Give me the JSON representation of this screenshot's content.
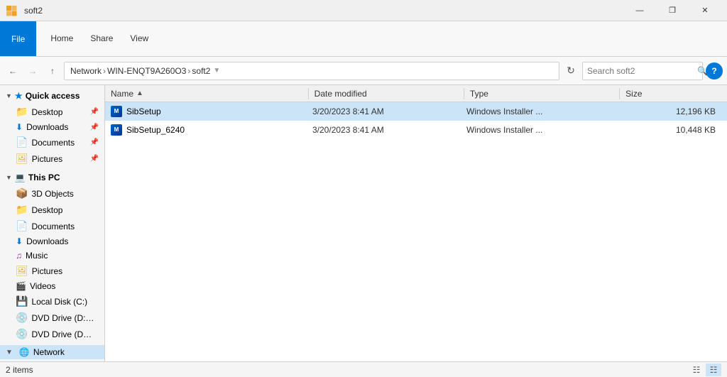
{
  "titleBar": {
    "title": "soft2",
    "minimizeLabel": "—",
    "restoreLabel": "❐",
    "closeLabel": "✕"
  },
  "ribbon": {
    "fileLabel": "File",
    "tabs": [
      "Home",
      "Share",
      "View"
    ]
  },
  "addressBar": {
    "backTitle": "Back",
    "forwardTitle": "Forward",
    "upTitle": "Up",
    "pathParts": [
      "Network",
      "WIN-ENQT9A260O3",
      "soft2"
    ],
    "refreshTitle": "Refresh",
    "searchPlaceholder": "Search soft2",
    "helpTitle": "?"
  },
  "sidebar": {
    "quickAccessLabel": "Quick access",
    "desktopLabel": "Desktop",
    "downloadsLabel": "Downloads",
    "documentsLabel": "Documents",
    "picturesLabel": "Pictures",
    "thisPCLabel": "This PC",
    "threeDObjectsLabel": "3D Objects",
    "desktopPCLabel": "Desktop",
    "documentsPCLabel": "Documents",
    "downloadsPCLabel": "Downloads",
    "musicLabel": "Music",
    "picturesPCLabel": "Pictures",
    "videosLabel": "Videos",
    "localDiskLabel": "Local Disk (C:)",
    "dvdDrive1Label": "DVD Drive (D:) SSS_",
    "dvdDrive2Label": "DVD Drive (D:) SSS_X(",
    "networkLabel": "Network"
  },
  "columnHeaders": {
    "name": "Name",
    "dateModified": "Date modified",
    "type": "Type",
    "size": "Size"
  },
  "files": [
    {
      "name": "SibSetup",
      "dateModified": "3/20/2023 8:41 AM",
      "type": "Windows Installer ...",
      "size": "12,196 KB",
      "selected": true
    },
    {
      "name": "SibSetup_6240",
      "dateModified": "3/20/2023 8:41 AM",
      "type": "Windows Installer ...",
      "size": "10,448 KB",
      "selected": false
    }
  ],
  "statusBar": {
    "itemCount": "2 items"
  }
}
